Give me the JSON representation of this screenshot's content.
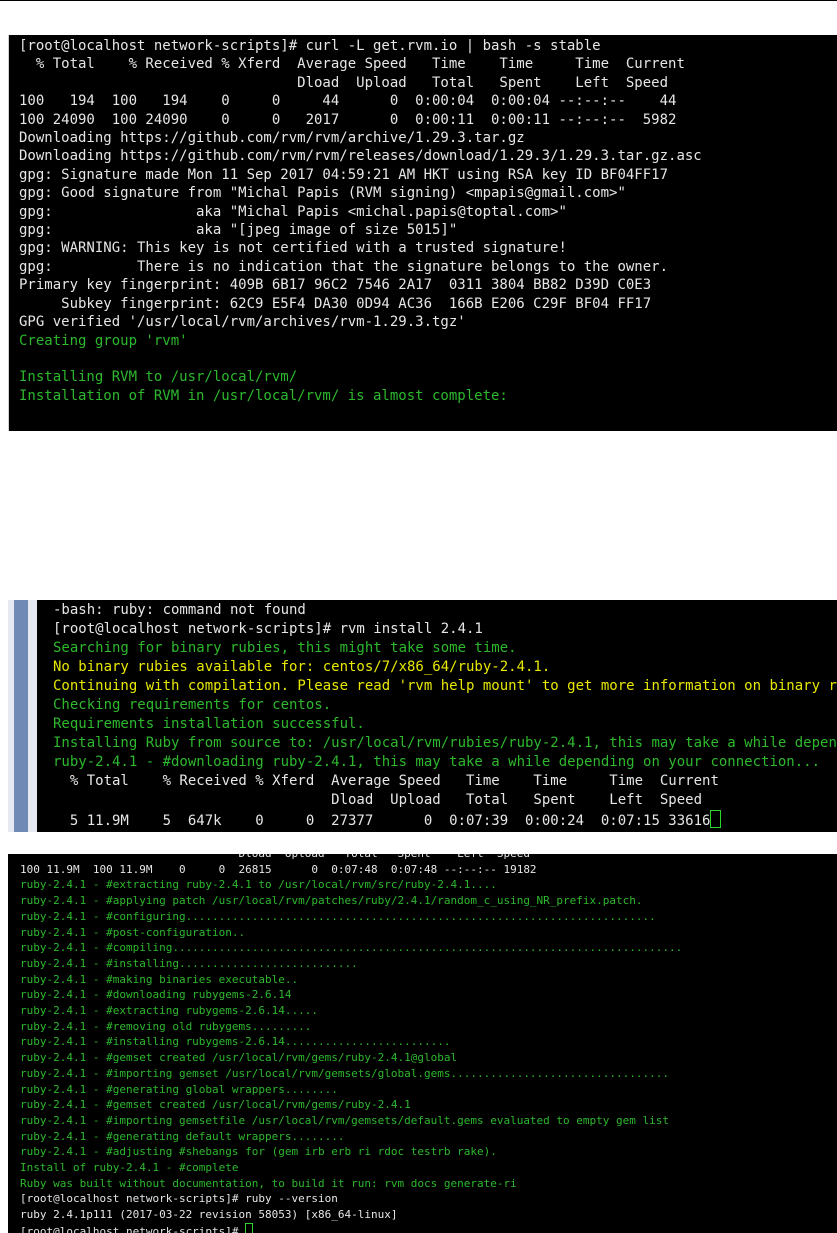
{
  "terminal_1": {
    "lines": [
      {
        "text": "[root@localhost network-scripts]# curl -L get.rvm.io | bash -s stable",
        "color": "white"
      },
      {
        "text": "  % Total    % Received % Xferd  Average Speed   Time    Time     Time  Current",
        "color": "white"
      },
      {
        "text": "                                 Dload  Upload   Total   Spent    Left  Speed",
        "color": "white"
      },
      {
        "text": "100   194  100   194    0     0     44      0  0:00:04  0:00:04 --:--:--    44",
        "color": "white"
      },
      {
        "text": "100 24090  100 24090    0     0   2017      0  0:00:11  0:00:11 --:--:--  5982",
        "color": "white"
      },
      {
        "text": "Downloading https://github.com/rvm/rvm/archive/1.29.3.tar.gz",
        "color": "white"
      },
      {
        "text": "Downloading https://github.com/rvm/rvm/releases/download/1.29.3/1.29.3.tar.gz.asc",
        "color": "white"
      },
      {
        "text": "gpg: Signature made Mon 11 Sep 2017 04:59:21 AM HKT using RSA key ID BF04FF17",
        "color": "white"
      },
      {
        "text": "gpg: Good signature from \"Michal Papis (RVM signing) <mpapis@gmail.com>\"",
        "color": "white"
      },
      {
        "text": "gpg:                 aka \"Michal Papis <michal.papis@toptal.com>\"",
        "color": "white"
      },
      {
        "text": "gpg:                 aka \"[jpeg image of size 5015]\"",
        "color": "white"
      },
      {
        "text": "gpg: WARNING: This key is not certified with a trusted signature!",
        "color": "white"
      },
      {
        "text": "gpg:          There is no indication that the signature belongs to the owner.",
        "color": "white"
      },
      {
        "text": "Primary key fingerprint: 409B 6B17 96C2 7546 2A17  0311 3804 BB82 D39D C0E3",
        "color": "white"
      },
      {
        "text": "     Subkey fingerprint: 62C9 E5F4 DA30 0D94 AC36  166B E206 C29F BF04 FF17",
        "color": "white"
      },
      {
        "text": "GPG verified '/usr/local/rvm/archives/rvm-1.29.3.tgz'",
        "color": "white"
      },
      {
        "text": "Creating group 'rvm'",
        "color": "green"
      },
      {
        "text": " ",
        "color": "green"
      },
      {
        "text": "Installing RVM to /usr/local/rvm/",
        "color": "green"
      },
      {
        "text": "Installation of RVM in /usr/local/rvm/ is almost complete:",
        "color": "green"
      }
    ]
  },
  "terminal_2": {
    "lines": [
      {
        "text": "-bash: ruby: command not found",
        "color": "white"
      },
      {
        "text": "[root@localhost network-scripts]# rvm install 2.4.1",
        "color": "white"
      },
      {
        "text": "Searching for binary rubies, this might take some time.",
        "color": "green"
      },
      {
        "text": "No binary rubies available for: centos/7/x86_64/ruby-2.4.1.",
        "color": "yellow"
      },
      {
        "text": "Continuing with compilation. Please read 'rvm help mount' to get more information on binary rubies.",
        "color": "yellow"
      },
      {
        "text": "Checking requirements for centos.",
        "color": "green"
      },
      {
        "text": "Requirements installation successful.",
        "color": "green"
      },
      {
        "text": "Installing Ruby from source to: /usr/local/rvm/rubies/ruby-2.4.1, this may take a while depending on your cpu(s)...",
        "color": "green"
      },
      {
        "text": "ruby-2.4.1 - #downloading ruby-2.4.1, this may take a while depending on your connection...",
        "color": "green"
      },
      {
        "text": "  % Total    % Received % Xferd  Average Speed   Time    Time     Time  Current",
        "color": "white"
      },
      {
        "text": "                                 Dload  Upload   Total   Spent    Left  Speed",
        "color": "white"
      }
    ],
    "progress_line": "  5 11.9M    5  647k    0     0  27377      0  0:07:39  0:00:24  0:07:15 33616"
  },
  "terminal_3": {
    "lines": [
      {
        "text": "                                 Dload  Upload   Total   Spent    Left  Speed",
        "color": "white"
      },
      {
        "text": "100 11.9M  100 11.9M    0     0  26815      0  0:07:48  0:07:48 --:--:-- 19182",
        "color": "white"
      },
      {
        "text": "ruby-2.4.1 - #extracting ruby-2.4.1 to /usr/local/rvm/src/ruby-2.4.1....",
        "color": "green"
      },
      {
        "text": "ruby-2.4.1 - #applying patch /usr/local/rvm/patches/ruby/2.4.1/random_c_using_NR_prefix.patch.",
        "color": "green"
      },
      {
        "text": "ruby-2.4.1 - #configuring.......................................................................",
        "color": "green"
      },
      {
        "text": "ruby-2.4.1 - #post-configuration..",
        "color": "green"
      },
      {
        "text": "ruby-2.4.1 - #compiling.............................................................................",
        "color": "green"
      },
      {
        "text": "ruby-2.4.1 - #installing...........................",
        "color": "green"
      },
      {
        "text": "ruby-2.4.1 - #making binaries executable..",
        "color": "green"
      },
      {
        "text": "ruby-2.4.1 - #downloading rubygems-2.6.14",
        "color": "green"
      },
      {
        "text": "ruby-2.4.1 - #extracting rubygems-2.6.14.....",
        "color": "green"
      },
      {
        "text": "ruby-2.4.1 - #removing old rubygems.........",
        "color": "green"
      },
      {
        "text": "ruby-2.4.1 - #installing rubygems-2.6.14.........................",
        "color": "green"
      },
      {
        "text": "ruby-2.4.1 - #gemset created /usr/local/rvm/gems/ruby-2.4.1@global",
        "color": "green"
      },
      {
        "text": "ruby-2.4.1 - #importing gemset /usr/local/rvm/gemsets/global.gems.................................",
        "color": "green"
      },
      {
        "text": "ruby-2.4.1 - #generating global wrappers........",
        "color": "green"
      },
      {
        "text": "ruby-2.4.1 - #gemset created /usr/local/rvm/gems/ruby-2.4.1",
        "color": "green"
      },
      {
        "text": "ruby-2.4.1 - #importing gemsetfile /usr/local/rvm/gemsets/default.gems evaluated to empty gem list",
        "color": "green"
      },
      {
        "text": "ruby-2.4.1 - #generating default wrappers........",
        "color": "green"
      },
      {
        "text": "ruby-2.4.1 - #adjusting #shebangs for (gem irb erb ri rdoc testrb rake).",
        "color": "green"
      },
      {
        "text": "Install of ruby-2.4.1 - #complete",
        "color": "green"
      },
      {
        "text": "Ruby was built without documentation, to build it run: rvm docs generate-ri",
        "color": "green"
      },
      {
        "text": "[root@localhost network-scripts]# ruby --version",
        "color": "white"
      },
      {
        "text": "ruby 2.4.1p111 (2017-03-22 revision 58053) [x86_64-linux]",
        "color": "white"
      }
    ],
    "prompt_line": "[root@localhost network-scripts]# "
  }
}
